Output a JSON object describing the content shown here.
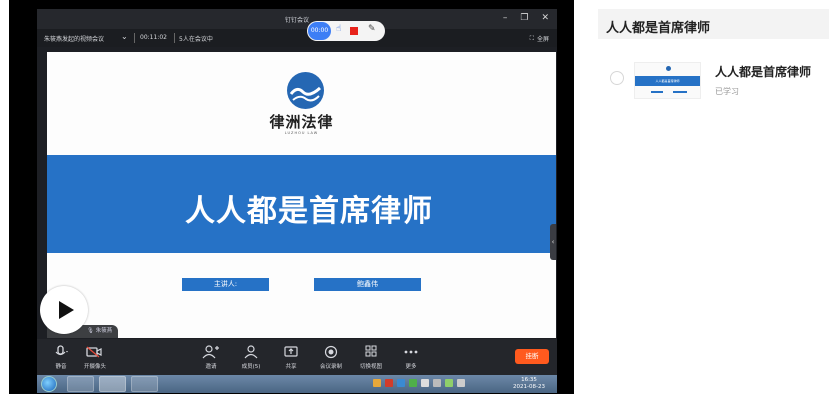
{
  "window": {
    "title": "钉钉会议"
  },
  "meeting": {
    "title": "朱筱燕发起的视频会议",
    "timer": "00:11:02",
    "participants": "5人在会议中",
    "fullscreen_label": "全屏"
  },
  "recorder": {
    "time": "00:00"
  },
  "slide": {
    "brand_name": "律洲法律",
    "brand_sub": "LUZHOU LAW",
    "headline": "人人都是首席律师",
    "host_label": "主讲人:",
    "host_name": "鲍鑫伟"
  },
  "speaker": {
    "name": "朱筱燕"
  },
  "controls": [
    {
      "label": "静音",
      "icon": "microphone-icon"
    },
    {
      "label": "开摄像头",
      "icon": "camera-icon"
    },
    {
      "label": "邀请",
      "icon": "invite-icon"
    },
    {
      "label": "成员(5)",
      "icon": "members-icon"
    },
    {
      "label": "共享",
      "icon": "share-icon"
    },
    {
      "label": "会议录制",
      "icon": "record-icon"
    },
    {
      "label": "切换视图",
      "icon": "grid-view-icon"
    },
    {
      "label": "更多",
      "icon": "more-icon"
    }
  ],
  "end_button": "挂断",
  "taskbar": {
    "time": "16:35",
    "date": "2021-08-23"
  },
  "panel": {
    "title": "人人都是首席律师",
    "lessons": [
      {
        "title": "人人都是首席律师",
        "status": "已学习"
      }
    ]
  },
  "colors": {
    "slide_blue": "#2672c6",
    "end_button": "#ff5a1e",
    "recorder_blue": "#3d7ef5",
    "stop_red": "#e8231b"
  }
}
